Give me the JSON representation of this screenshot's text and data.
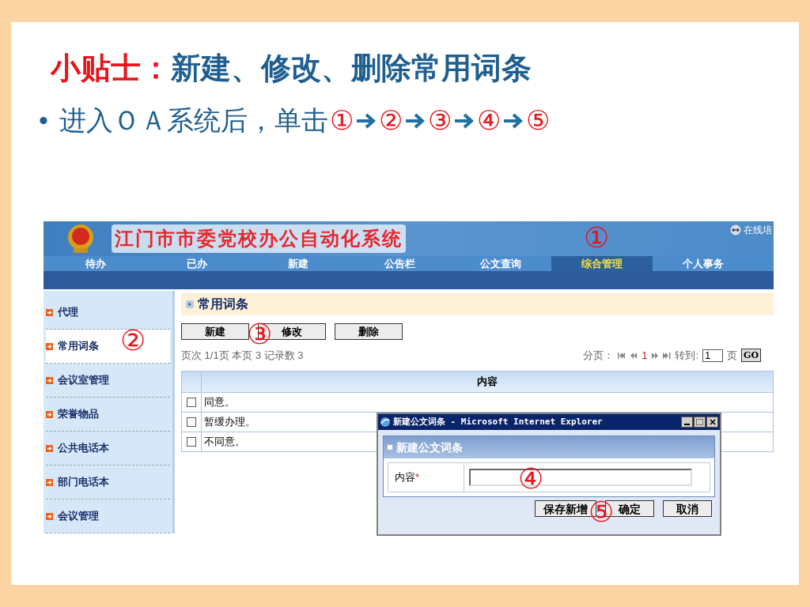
{
  "slide": {
    "title_prefix": "小贴士：",
    "title": "新建、修改、删除常用词条",
    "bullet_mark": "•",
    "bullet": "进入ＯＡ系统后，单击",
    "steps": [
      "①",
      "②",
      "③",
      "④",
      "⑤"
    ]
  },
  "app": {
    "title": "江门市市委党校办公自动化系统",
    "online_link": "在线培",
    "nav": [
      {
        "label": "待办",
        "selected": false
      },
      {
        "label": "已办",
        "selected": false
      },
      {
        "label": "新建",
        "selected": false
      },
      {
        "label": "公告栏",
        "selected": false
      },
      {
        "label": "公文查询",
        "selected": false
      },
      {
        "label": "综合管理",
        "selected": true
      },
      {
        "label": "个人事务",
        "selected": false
      }
    ],
    "sidebar": [
      {
        "label": "代理",
        "selected": false
      },
      {
        "label": "常用词条",
        "selected": true
      },
      {
        "label": "会议室管理",
        "selected": false
      },
      {
        "label": "荣誉物品",
        "selected": false
      },
      {
        "label": "公共电话本",
        "selected": false
      },
      {
        "label": "部门电话本",
        "selected": false
      },
      {
        "label": "会议管理",
        "selected": false
      }
    ],
    "panel_title": "常用词条",
    "buttons": [
      "新建",
      "修改",
      "删除"
    ],
    "record_info": "页次 1/1页 本页 3 记录数 3",
    "pager": {
      "label": "分页：",
      "current": "1",
      "goto_label": "转到:",
      "goto_value": "1",
      "page_unit": "页",
      "go_button": "GO"
    },
    "table": {
      "column": "内容",
      "rows": [
        {
          "checked": false,
          "content": "同意。"
        },
        {
          "checked": false,
          "content": "暂缓办理。"
        },
        {
          "checked": false,
          "content": "不同意。"
        }
      ]
    }
  },
  "dialog": {
    "title": "新建公文词条 - Microsoft Internet Explorer",
    "header": "新建公文词条",
    "field_label": "内容",
    "required_mark": "*",
    "buttons": [
      "保存新增",
      "确定",
      "取消"
    ]
  },
  "callouts": [
    "①",
    "②",
    "③",
    "④",
    "⑤"
  ]
}
